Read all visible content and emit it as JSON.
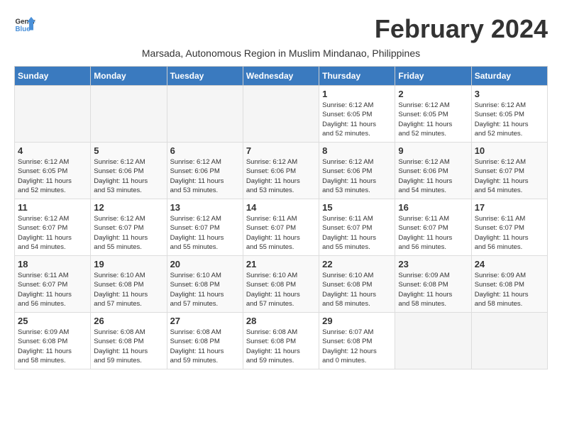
{
  "logo": {
    "line1": "General",
    "line2": "Blue"
  },
  "title": "February 2024",
  "subtitle": "Marsada, Autonomous Region in Muslim Mindanao, Philippines",
  "days_header": [
    "Sunday",
    "Monday",
    "Tuesday",
    "Wednesday",
    "Thursday",
    "Friday",
    "Saturday"
  ],
  "weeks": [
    [
      {
        "day": "",
        "info": ""
      },
      {
        "day": "",
        "info": ""
      },
      {
        "day": "",
        "info": ""
      },
      {
        "day": "",
        "info": ""
      },
      {
        "day": "1",
        "info": "Sunrise: 6:12 AM\nSunset: 6:05 PM\nDaylight: 11 hours\nand 52 minutes."
      },
      {
        "day": "2",
        "info": "Sunrise: 6:12 AM\nSunset: 6:05 PM\nDaylight: 11 hours\nand 52 minutes."
      },
      {
        "day": "3",
        "info": "Sunrise: 6:12 AM\nSunset: 6:05 PM\nDaylight: 11 hours\nand 52 minutes."
      }
    ],
    [
      {
        "day": "4",
        "info": "Sunrise: 6:12 AM\nSunset: 6:05 PM\nDaylight: 11 hours\nand 52 minutes."
      },
      {
        "day": "5",
        "info": "Sunrise: 6:12 AM\nSunset: 6:06 PM\nDaylight: 11 hours\nand 53 minutes."
      },
      {
        "day": "6",
        "info": "Sunrise: 6:12 AM\nSunset: 6:06 PM\nDaylight: 11 hours\nand 53 minutes."
      },
      {
        "day": "7",
        "info": "Sunrise: 6:12 AM\nSunset: 6:06 PM\nDaylight: 11 hours\nand 53 minutes."
      },
      {
        "day": "8",
        "info": "Sunrise: 6:12 AM\nSunset: 6:06 PM\nDaylight: 11 hours\nand 53 minutes."
      },
      {
        "day": "9",
        "info": "Sunrise: 6:12 AM\nSunset: 6:06 PM\nDaylight: 11 hours\nand 54 minutes."
      },
      {
        "day": "10",
        "info": "Sunrise: 6:12 AM\nSunset: 6:07 PM\nDaylight: 11 hours\nand 54 minutes."
      }
    ],
    [
      {
        "day": "11",
        "info": "Sunrise: 6:12 AM\nSunset: 6:07 PM\nDaylight: 11 hours\nand 54 minutes."
      },
      {
        "day": "12",
        "info": "Sunrise: 6:12 AM\nSunset: 6:07 PM\nDaylight: 11 hours\nand 55 minutes."
      },
      {
        "day": "13",
        "info": "Sunrise: 6:12 AM\nSunset: 6:07 PM\nDaylight: 11 hours\nand 55 minutes."
      },
      {
        "day": "14",
        "info": "Sunrise: 6:11 AM\nSunset: 6:07 PM\nDaylight: 11 hours\nand 55 minutes."
      },
      {
        "day": "15",
        "info": "Sunrise: 6:11 AM\nSunset: 6:07 PM\nDaylight: 11 hours\nand 55 minutes."
      },
      {
        "day": "16",
        "info": "Sunrise: 6:11 AM\nSunset: 6:07 PM\nDaylight: 11 hours\nand 56 minutes."
      },
      {
        "day": "17",
        "info": "Sunrise: 6:11 AM\nSunset: 6:07 PM\nDaylight: 11 hours\nand 56 minutes."
      }
    ],
    [
      {
        "day": "18",
        "info": "Sunrise: 6:11 AM\nSunset: 6:07 PM\nDaylight: 11 hours\nand 56 minutes."
      },
      {
        "day": "19",
        "info": "Sunrise: 6:10 AM\nSunset: 6:08 PM\nDaylight: 11 hours\nand 57 minutes."
      },
      {
        "day": "20",
        "info": "Sunrise: 6:10 AM\nSunset: 6:08 PM\nDaylight: 11 hours\nand 57 minutes."
      },
      {
        "day": "21",
        "info": "Sunrise: 6:10 AM\nSunset: 6:08 PM\nDaylight: 11 hours\nand 57 minutes."
      },
      {
        "day": "22",
        "info": "Sunrise: 6:10 AM\nSunset: 6:08 PM\nDaylight: 11 hours\nand 58 minutes."
      },
      {
        "day": "23",
        "info": "Sunrise: 6:09 AM\nSunset: 6:08 PM\nDaylight: 11 hours\nand 58 minutes."
      },
      {
        "day": "24",
        "info": "Sunrise: 6:09 AM\nSunset: 6:08 PM\nDaylight: 11 hours\nand 58 minutes."
      }
    ],
    [
      {
        "day": "25",
        "info": "Sunrise: 6:09 AM\nSunset: 6:08 PM\nDaylight: 11 hours\nand 58 minutes."
      },
      {
        "day": "26",
        "info": "Sunrise: 6:08 AM\nSunset: 6:08 PM\nDaylight: 11 hours\nand 59 minutes."
      },
      {
        "day": "27",
        "info": "Sunrise: 6:08 AM\nSunset: 6:08 PM\nDaylight: 11 hours\nand 59 minutes."
      },
      {
        "day": "28",
        "info": "Sunrise: 6:08 AM\nSunset: 6:08 PM\nDaylight: 11 hours\nand 59 minutes."
      },
      {
        "day": "29",
        "info": "Sunrise: 6:07 AM\nSunset: 6:08 PM\nDaylight: 12 hours\nand 0 minutes."
      },
      {
        "day": "",
        "info": ""
      },
      {
        "day": "",
        "info": ""
      }
    ]
  ]
}
